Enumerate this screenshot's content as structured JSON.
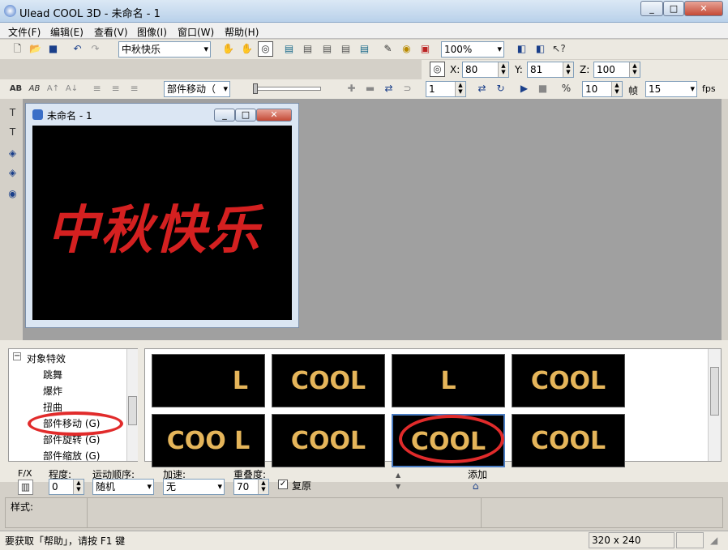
{
  "window": {
    "title": "Ulead COOL 3D - 未命名 - 1",
    "min_icon": "minimize-icon",
    "max_icon": "maximize-icon",
    "close_icon": "close-icon"
  },
  "menu": [
    "文件(F)",
    "编辑(E)",
    "查看(V)",
    "图像(I)",
    "窗口(W)",
    "帮助(H)"
  ],
  "toolbar1": {
    "text_value": "中秋快乐",
    "zoom": "100%"
  },
  "coords": {
    "x_label": "X:",
    "x_value": "80",
    "y_label": "Y:",
    "y_value": "81",
    "z_label": "Z:",
    "z_value": "100"
  },
  "toolbar3": {
    "effect_select": "部件移动（",
    "frame_value": "1",
    "fps_frames": "10",
    "frame_label": "帧",
    "fps_value": "15",
    "fps_label": "fps"
  },
  "doc": {
    "title": "未命名 - 1",
    "canvas_text": "中秋快乐"
  },
  "tree": {
    "root": "对象特效",
    "items": [
      "跳舞",
      "爆炸",
      "扭曲",
      "部件移动 (G)",
      "部件旋转 (G)",
      "部件缩放 (G)"
    ]
  },
  "thumbs": [
    "L",
    "COOL",
    "L",
    "COOL",
    "COO L",
    "COOL",
    "COOL",
    "COOL"
  ],
  "props": {
    "fx_label": "F/X",
    "degree_label": "程度:",
    "degree_value": "0",
    "order_label": "运动顺序:",
    "order_value": "随机",
    "speed_label": "加速:",
    "speed_value": "无",
    "overlap_label": "重叠度:",
    "overlap_value": "70",
    "restore_label": "复原",
    "add_label": "添加",
    "style_label": "样式:"
  },
  "status": {
    "help": "要获取「帮助」，请按 F1 键",
    "size": "320 x 240"
  },
  "colors": {
    "highlight": "#e12b2b",
    "thumb_text": "#e5b55a",
    "canvas_text": "#d42020"
  }
}
